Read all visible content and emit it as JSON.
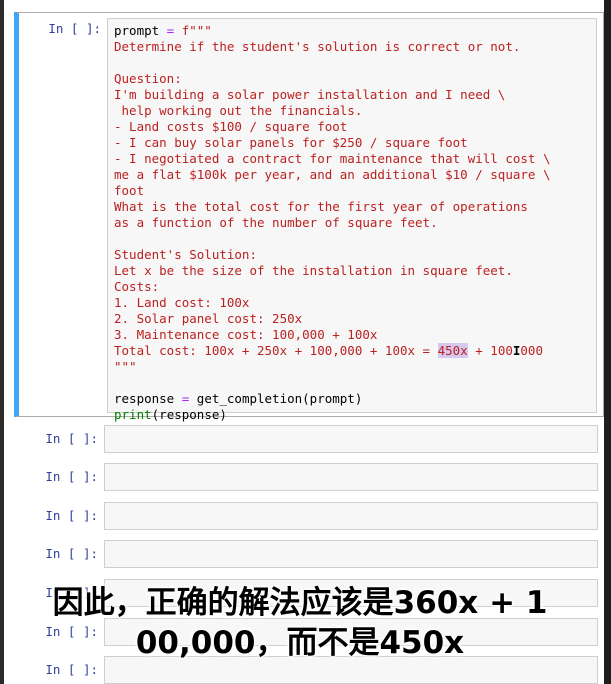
{
  "code_cell": {
    "prompt": "In [ ]:",
    "lines": {
      "l1_var": "prompt",
      "l1_op": " = ",
      "l1_str": "f\"\"\"",
      "l2": "Determine if the student's solution is correct or not.",
      "l3": "",
      "l4": "Question:",
      "l5": "I'm building a solar power installation and I need \\",
      "l6": " help working out the financials.",
      "l7": "- Land costs $100 / square foot",
      "l8": "- I can buy solar panels for $250 / square foot",
      "l9": "- I negotiated a contract for maintenance that will cost \\",
      "l10": "me a flat $100k per year, and an additional $10 / square \\",
      "l11": "foot",
      "l12": "What is the total cost for the first year of operations",
      "l13": "as a function of the number of square feet.",
      "l14": "",
      "l15": "Student's Solution:",
      "l16": "Let x be the size of the installation in square feet.",
      "l17": "Costs:",
      "l18": "1. Land cost: 100x",
      "l19": "2. Solar panel cost: 250x",
      "l20": "3. Maintenance cost: 100,000 + 100x",
      "l21_a": "Total cost: 100x + 250x + 100,000 + 100x = ",
      "l21_hl": "450x",
      "l21_b": " + 100",
      "l21_c": "000",
      "l22": "\"\"\"",
      "l23": "",
      "l24_var": "response",
      "l24_op": " = ",
      "l24_rest": "get_completion(prompt)",
      "l25_kw": "print",
      "l25_rest": "(response)"
    }
  },
  "empty_cells": [
    {
      "prompt": "In [ ]:"
    },
    {
      "prompt": "In [ ]:"
    },
    {
      "prompt": "In [ ]:"
    },
    {
      "prompt": "In [ ]:"
    },
    {
      "prompt": "In [ ]:"
    },
    {
      "prompt": "In [ ]:"
    },
    {
      "prompt": "In [ ]:"
    }
  ],
  "subtitle": "因此，正确的解法应该是360x + 1\n00,000，而不是450x"
}
